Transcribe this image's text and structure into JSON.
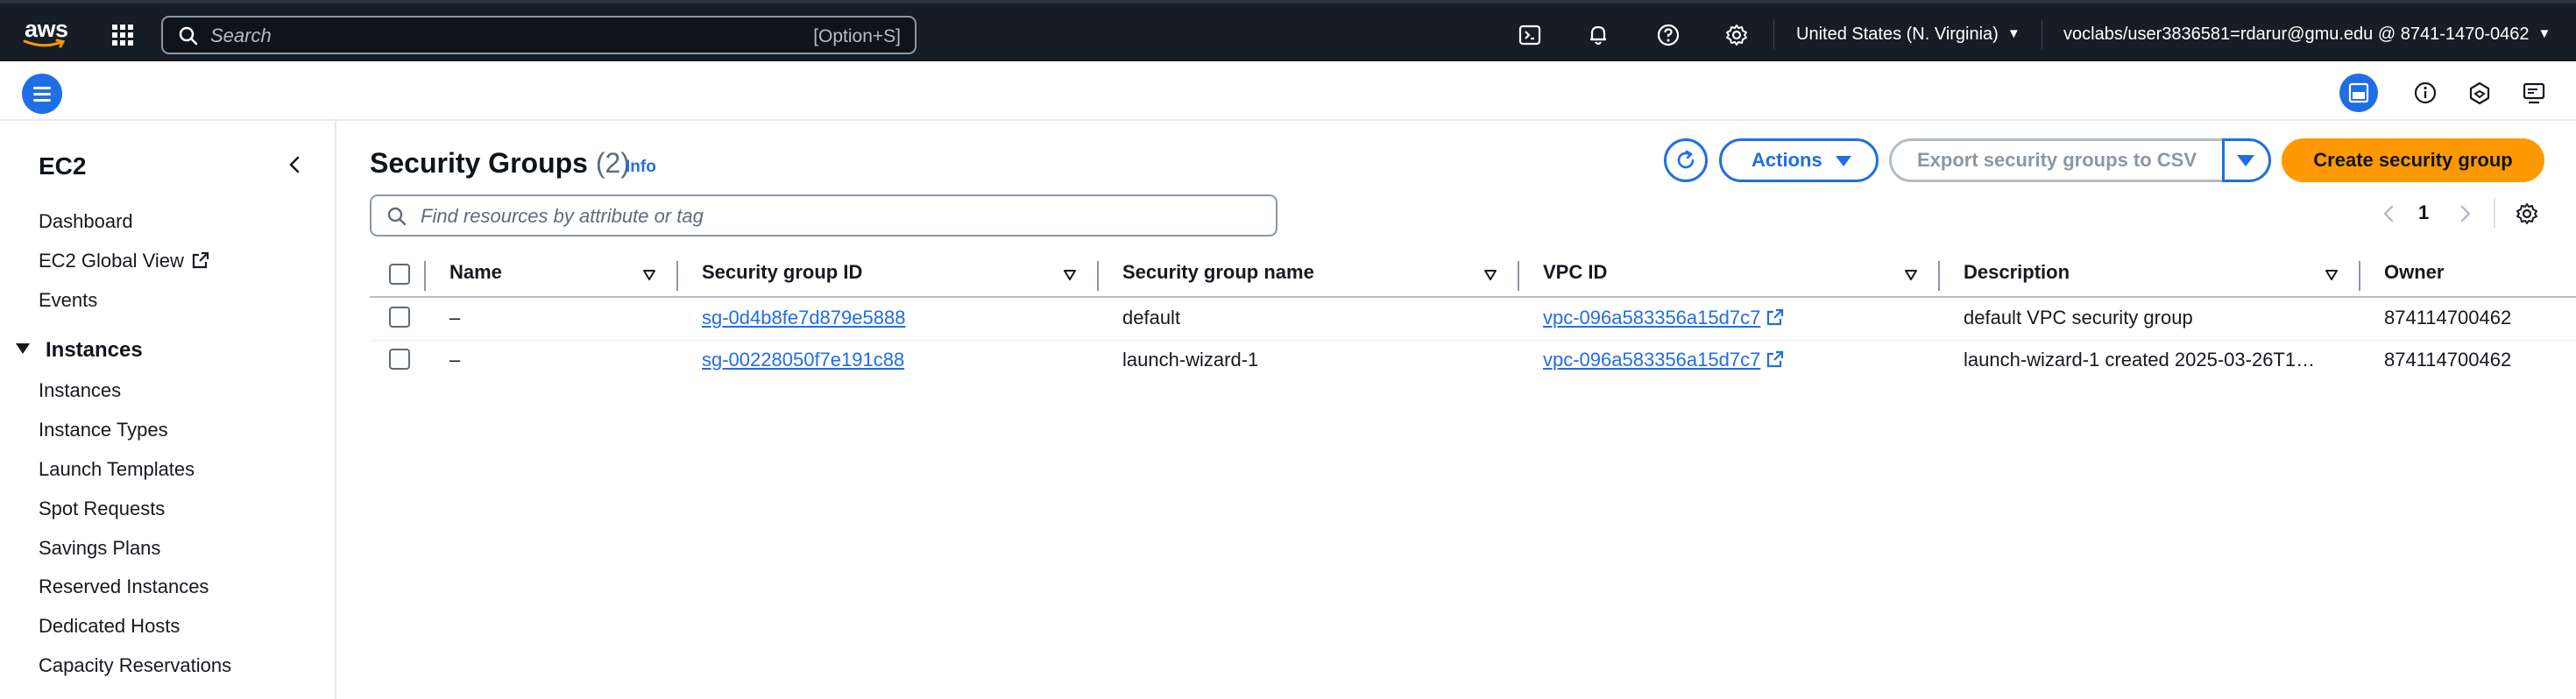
{
  "topnav": {
    "logo_text": "aws",
    "search_placeholder": "Search",
    "search_shortcut": "[Option+S]",
    "region": "United States (N. Virginia)",
    "account": "voclabs/user3836581=rdarur@gmu.edu @ 8741-1470-0462"
  },
  "sidebar": {
    "title": "EC2",
    "top_links": [
      "Dashboard",
      "EC2 Global View",
      "Events"
    ],
    "section": "Instances",
    "section_links": [
      "Instances",
      "Instance Types",
      "Launch Templates",
      "Spot Requests",
      "Savings Plans",
      "Reserved Instances",
      "Dedicated Hosts",
      "Capacity Reservations"
    ]
  },
  "main": {
    "title": "Security Groups",
    "count": "(2)",
    "info": "Info",
    "actions_label": "Actions",
    "export_label": "Export security groups to CSV",
    "create_label": "Create security group",
    "filter_placeholder": "Find resources by attribute or tag",
    "page_number": "1"
  },
  "table": {
    "columns": [
      "Name",
      "Security group ID",
      "Security group name",
      "VPC ID",
      "Description",
      "Owner"
    ],
    "rows": [
      [
        "–",
        "sg-0d4b8fe7d879e5888",
        "default",
        "vpc-096a583356a15d7c7",
        "default VPC security group",
        "874114700462"
      ],
      [
        "–",
        "sg-00228050f7e191c88",
        "launch-wizard-1",
        "vpc-096a583356a15d7c7",
        "launch-wizard-1 created 2025-03-26T1…",
        "874114700462"
      ]
    ]
  },
  "colors": {
    "nav_bg": "#161d26",
    "accent": "#1f6ee5",
    "primary_button": "#ff9900"
  }
}
